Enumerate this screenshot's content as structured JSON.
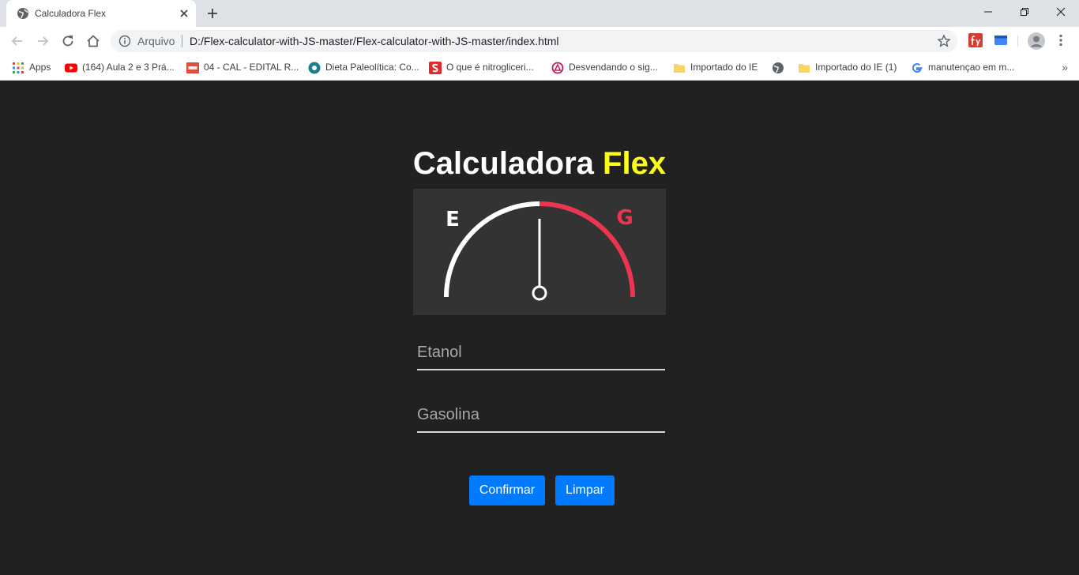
{
  "browser": {
    "tab_title": "Calculadora Flex",
    "address_scheme": "Arquivo",
    "address_url": "D:/Flex-calculator-with-JS-master/Flex-calculator-with-JS-master/index.html",
    "bookmarks": [
      {
        "label": "Apps",
        "icon": "apps-grid-icon"
      },
      {
        "label": "(164) Aula 2 e 3 Prá...",
        "icon": "youtube-icon"
      },
      {
        "label": "04 - CAL - EDITAL R...",
        "icon": "pdf-icon"
      },
      {
        "label": "Dieta Paleolítica: Co...",
        "icon": "site-icon"
      },
      {
        "label": "O que é nitrogliceri...",
        "icon": "s-logo-icon"
      },
      {
        "label": "Desvendando o sig...",
        "icon": "site-icon"
      },
      {
        "label": "Importado do IE",
        "icon": "folder-icon"
      },
      {
        "label": "Importado do IE (1)",
        "icon": "folder-icon"
      },
      {
        "label": "manutençao em m...",
        "icon": "google-icon"
      }
    ],
    "more_bookmarks": "»"
  },
  "app": {
    "title_main": "Calculadora",
    "title_accent": "Flex",
    "gauge": {
      "left_label": "E",
      "right_label": "G",
      "needle_level": 0.5
    },
    "etanol_placeholder": "Etanol",
    "gasolina_placeholder": "Gasolina",
    "confirm_label": "Confirmar",
    "clear_label": "Limpar"
  },
  "colors": {
    "page_bg": "#212121",
    "gauge_bg": "#333333",
    "accent_yellow": "#ffff14",
    "gasoline_red": "#ed354f",
    "button_blue": "#007bff"
  }
}
